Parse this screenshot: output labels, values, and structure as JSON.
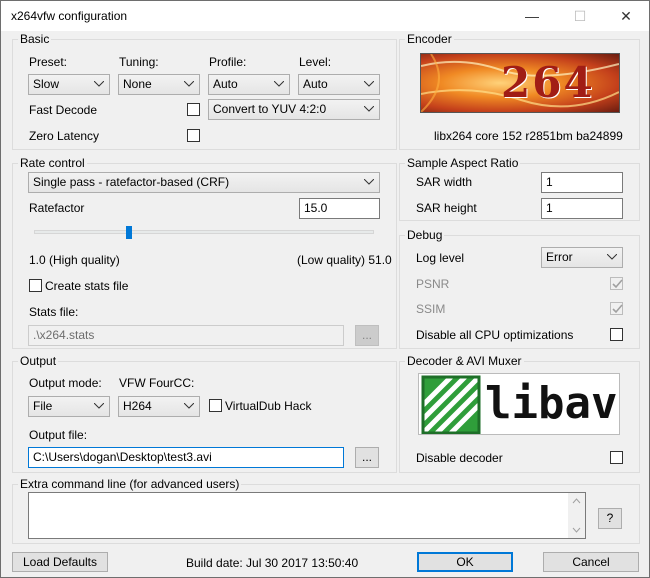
{
  "window": {
    "title": "x264vfw configuration",
    "minimize": "—",
    "maximize": "☐",
    "close": "✕"
  },
  "basic": {
    "title": "Basic",
    "preset_label": "Preset:",
    "preset_value": "Slow",
    "tuning_label": "Tuning:",
    "tuning_value": "None",
    "profile_label": "Profile:",
    "profile_value": "Auto",
    "level_label": "Level:",
    "level_value": "Auto",
    "fast_decode_label": "Fast Decode",
    "zero_latency_label": "Zero Latency",
    "colorspace_value": "Convert to YUV 4:2:0"
  },
  "encoder": {
    "title": "Encoder",
    "logo_text": "264",
    "version": "libx264 core 152 r2851bm ba24899"
  },
  "rate_control": {
    "title": "Rate control",
    "mode_value": "Single pass - ratefactor-based (CRF)",
    "ratefactor_label": "Ratefactor",
    "ratefactor_value": "15.0",
    "slider_min_label": "1.0 (High quality)",
    "slider_max_label": "(Low quality) 51.0",
    "slider_fraction": 0.28,
    "create_stats_label": "Create stats file",
    "stats_file_label": "Stats file:",
    "stats_file_value": ".\\x264.stats",
    "browse_label": "..."
  },
  "sar": {
    "title": "Sample Aspect Ratio",
    "width_label": "SAR width",
    "width_value": "1",
    "height_label": "SAR height",
    "height_value": "1"
  },
  "debug": {
    "title": "Debug",
    "log_level_label": "Log level",
    "log_level_value": "Error",
    "psnr_label": "PSNR",
    "ssim_label": "SSIM",
    "disable_cpu_label": "Disable all CPU optimizations"
  },
  "output": {
    "title": "Output",
    "mode_label": "Output mode:",
    "mode_value": "File",
    "fourcc_label": "VFW FourCC:",
    "fourcc_value": "H264",
    "vdub_label": "VirtualDub Hack",
    "file_label": "Output file:",
    "file_value": "C:\\Users\\dogan\\Desktop\\test3.avi",
    "browse_label": "..."
  },
  "decoder": {
    "title": "Decoder & AVI Muxer",
    "logo_text": "libav",
    "disable_label": "Disable decoder"
  },
  "extra": {
    "title": "Extra command line (for advanced users)",
    "value": "",
    "help_label": "?"
  },
  "footer": {
    "load_defaults": "Load Defaults",
    "build_date": "Build date: Jul 30 2017 13:50:40",
    "ok": "OK",
    "cancel": "Cancel"
  },
  "colors": {
    "accent": "#0078d7",
    "logo_red": "#b8231a",
    "libav_green": "#2f9e3a"
  }
}
